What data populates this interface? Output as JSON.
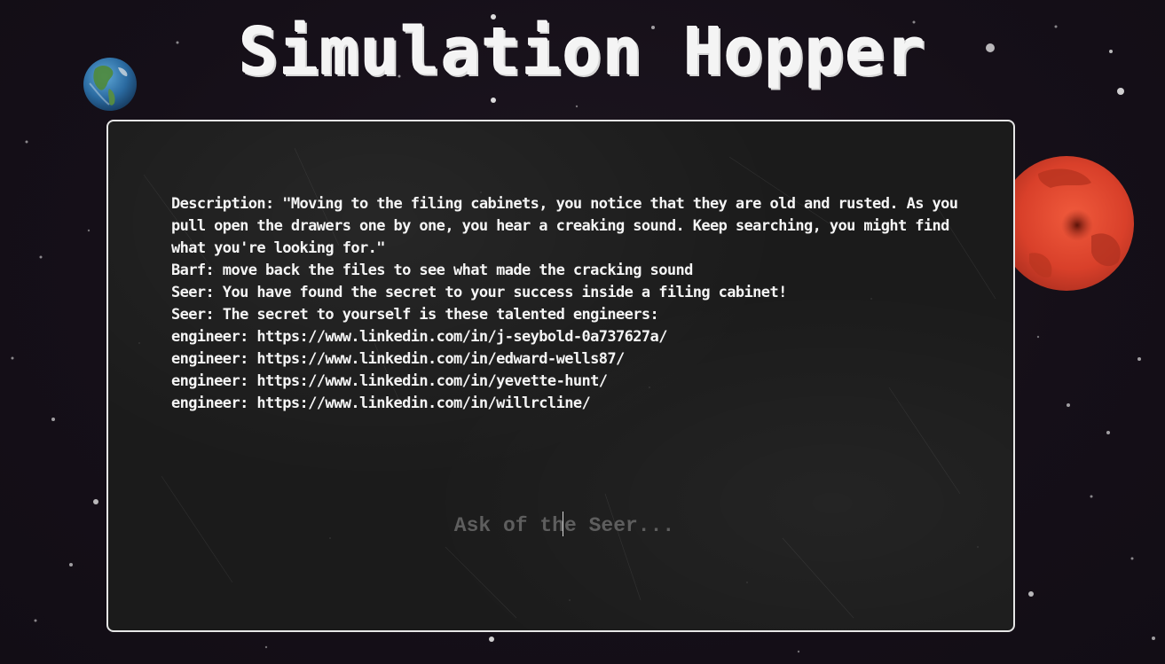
{
  "app": {
    "title": "Simulation Hopper"
  },
  "planets": {
    "left": "earth-icon",
    "right": "mars-icon"
  },
  "colors": {
    "background": "#161019",
    "console_bg": "#1b1b1b",
    "console_border": "#e6e6e6",
    "text": "#f5f5f5",
    "placeholder": "#5e5e5e",
    "mars": "#d9402a"
  },
  "console": {
    "log": [
      "Description: \"Moving to the filing cabinets, you notice that they are old and rusted. As you pull open the drawers one by one, you hear a creaking sound. Keep searching, you might find what you're looking for.\"",
      "Barf: move back the files to see what made the cracking sound",
      "Seer: You have found the secret to your success inside a filing cabinet!",
      "Seer: The secret to yourself is these talented engineers:",
      "engineer: https://www.linkedin.com/in/j-seybold-0a737627a/",
      "engineer: https://www.linkedin.com/in/edward-wells87/",
      "engineer: https://www.linkedin.com/in/yevette-hunt/",
      "engineer: https://www.linkedin.com/in/willrcline/"
    ],
    "input": {
      "placeholder": "Ask of the Seer...",
      "value": ""
    }
  }
}
